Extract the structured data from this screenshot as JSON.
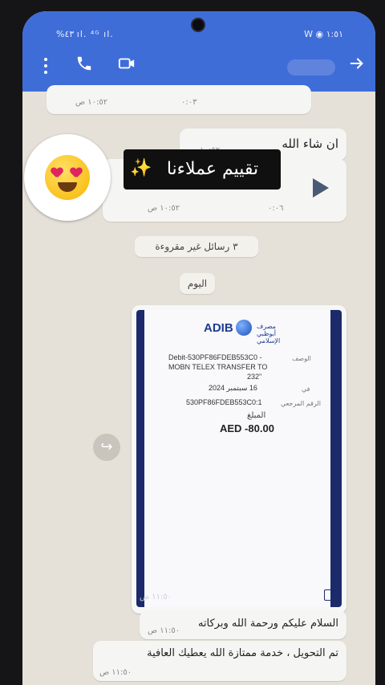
{
  "status_bar": {
    "left": "%٤٣ ıl. ⁴ᴳ ıl.",
    "right": "W ◉ ١:٥١"
  },
  "app_bar": {
    "menu_icon": "more-vert-icon",
    "call_icon": "phone-icon",
    "video_icon": "video-camera-icon",
    "back_icon": "arrow-right-icon"
  },
  "messages": {
    "top_partial": {
      "time": "١٠:٥٢ ص",
      "duration": "٠:٠٣"
    },
    "inshallah": {
      "text": "ان شاء الله",
      "time": "١٠:٥٢ ص"
    },
    "voice": {
      "time": "١٠:٥٢ ص",
      "duration": "٠:٠٦"
    },
    "unread_divider": "٣ رسائل غير مقروءة",
    "date_divider": "اليوم",
    "receipt": {
      "bank_name": "ADIB",
      "bank_arabic": "مصرف أبوظبي الإسلامي",
      "desc_label": "الوصف",
      "desc_line1": "Debit-530PF86FDEB553C0 -",
      "desc_line2": "MOBN TELEX TRANSFER TO",
      "desc_line3": "232\"",
      "date_label": "في",
      "date_value": "16 سبتمبر 2024",
      "ref_label": "الرقم المرجعي",
      "ref_value": "530PF86FDEB553C0:1",
      "amount_label": "المبلغ",
      "amount_value": "AED -80.00",
      "time": "١١:٥٠ ص"
    },
    "salam": {
      "text": "السلام عليكم ورحمة الله وبركاته",
      "time": "١١:٥٠ ص"
    },
    "thanks": {
      "text": "تم التحويل ، خدمة ممتازة الله يعطيك العافية",
      "time": "١١:٥٠ ص"
    }
  },
  "overlay": {
    "caption": "تقييم عملاءنا",
    "sparkle": "✨",
    "emoji": "heart-eyes-emoji"
  }
}
